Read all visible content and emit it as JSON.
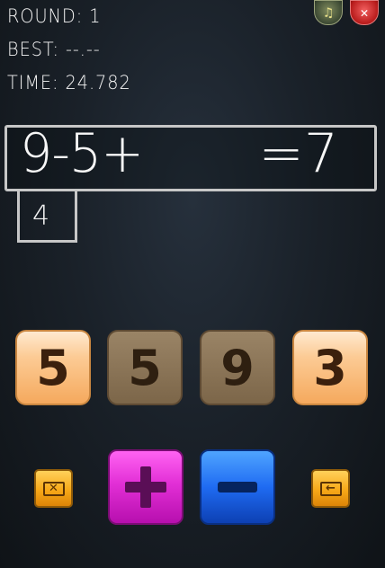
{
  "stats": {
    "round": "ROUND: 1",
    "best": "BEST: --.--",
    "time": "TIME: 24.782"
  },
  "top_controls": {
    "music_icon": "music-note-icon",
    "music_glyph": "♫",
    "close_icon": "close-icon",
    "close_glyph": "✕"
  },
  "equation": {
    "expression": "9-5+",
    "result": "=7"
  },
  "hint": "4",
  "tiles": [
    {
      "value": "5",
      "state": "available"
    },
    {
      "value": "5",
      "state": "used"
    },
    {
      "value": "9",
      "state": "used"
    },
    {
      "value": "3",
      "state": "available"
    }
  ],
  "operators": {
    "plus": "plus-icon",
    "minus": "minus-icon"
  },
  "side_buttons": {
    "clear_icon": "clear-icon",
    "clear_glyph": "✕",
    "backspace_icon": "backspace-arrow-icon",
    "backspace_glyph": "←"
  },
  "colors": {
    "tile_available": "#fccb95",
    "tile_used": "#8a7456",
    "plus_button": "#e22fd6",
    "minus_button": "#1f6bf2",
    "small_button": "#f7a818"
  }
}
